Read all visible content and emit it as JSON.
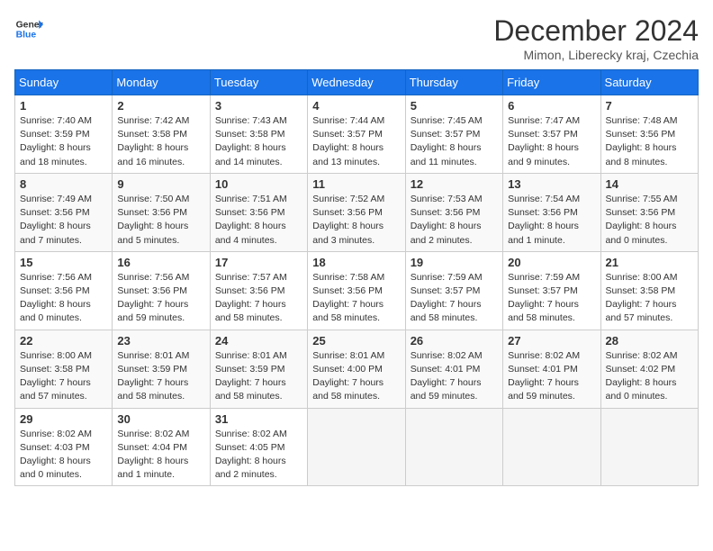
{
  "header": {
    "logo_line1": "General",
    "logo_line2": "Blue",
    "month_title": "December 2024",
    "subtitle": "Mimon, Liberecky kraj, Czechia"
  },
  "weekdays": [
    "Sunday",
    "Monday",
    "Tuesday",
    "Wednesday",
    "Thursday",
    "Friday",
    "Saturday"
  ],
  "weeks": [
    [
      {
        "day": "1",
        "info": "Sunrise: 7:40 AM\nSunset: 3:59 PM\nDaylight: 8 hours\nand 18 minutes."
      },
      {
        "day": "2",
        "info": "Sunrise: 7:42 AM\nSunset: 3:58 PM\nDaylight: 8 hours\nand 16 minutes."
      },
      {
        "day": "3",
        "info": "Sunrise: 7:43 AM\nSunset: 3:58 PM\nDaylight: 8 hours\nand 14 minutes."
      },
      {
        "day": "4",
        "info": "Sunrise: 7:44 AM\nSunset: 3:57 PM\nDaylight: 8 hours\nand 13 minutes."
      },
      {
        "day": "5",
        "info": "Sunrise: 7:45 AM\nSunset: 3:57 PM\nDaylight: 8 hours\nand 11 minutes."
      },
      {
        "day": "6",
        "info": "Sunrise: 7:47 AM\nSunset: 3:57 PM\nDaylight: 8 hours\nand 9 minutes."
      },
      {
        "day": "7",
        "info": "Sunrise: 7:48 AM\nSunset: 3:56 PM\nDaylight: 8 hours\nand 8 minutes."
      }
    ],
    [
      {
        "day": "8",
        "info": "Sunrise: 7:49 AM\nSunset: 3:56 PM\nDaylight: 8 hours\nand 7 minutes."
      },
      {
        "day": "9",
        "info": "Sunrise: 7:50 AM\nSunset: 3:56 PM\nDaylight: 8 hours\nand 5 minutes."
      },
      {
        "day": "10",
        "info": "Sunrise: 7:51 AM\nSunset: 3:56 PM\nDaylight: 8 hours\nand 4 minutes."
      },
      {
        "day": "11",
        "info": "Sunrise: 7:52 AM\nSunset: 3:56 PM\nDaylight: 8 hours\nand 3 minutes."
      },
      {
        "day": "12",
        "info": "Sunrise: 7:53 AM\nSunset: 3:56 PM\nDaylight: 8 hours\nand 2 minutes."
      },
      {
        "day": "13",
        "info": "Sunrise: 7:54 AM\nSunset: 3:56 PM\nDaylight: 8 hours\nand 1 minute."
      },
      {
        "day": "14",
        "info": "Sunrise: 7:55 AM\nSunset: 3:56 PM\nDaylight: 8 hours\nand 0 minutes."
      }
    ],
    [
      {
        "day": "15",
        "info": "Sunrise: 7:56 AM\nSunset: 3:56 PM\nDaylight: 8 hours\nand 0 minutes."
      },
      {
        "day": "16",
        "info": "Sunrise: 7:56 AM\nSunset: 3:56 PM\nDaylight: 7 hours\nand 59 minutes."
      },
      {
        "day": "17",
        "info": "Sunrise: 7:57 AM\nSunset: 3:56 PM\nDaylight: 7 hours\nand 58 minutes."
      },
      {
        "day": "18",
        "info": "Sunrise: 7:58 AM\nSunset: 3:56 PM\nDaylight: 7 hours\nand 58 minutes."
      },
      {
        "day": "19",
        "info": "Sunrise: 7:59 AM\nSunset: 3:57 PM\nDaylight: 7 hours\nand 58 minutes."
      },
      {
        "day": "20",
        "info": "Sunrise: 7:59 AM\nSunset: 3:57 PM\nDaylight: 7 hours\nand 58 minutes."
      },
      {
        "day": "21",
        "info": "Sunrise: 8:00 AM\nSunset: 3:58 PM\nDaylight: 7 hours\nand 57 minutes."
      }
    ],
    [
      {
        "day": "22",
        "info": "Sunrise: 8:00 AM\nSunset: 3:58 PM\nDaylight: 7 hours\nand 57 minutes."
      },
      {
        "day": "23",
        "info": "Sunrise: 8:01 AM\nSunset: 3:59 PM\nDaylight: 7 hours\nand 58 minutes."
      },
      {
        "day": "24",
        "info": "Sunrise: 8:01 AM\nSunset: 3:59 PM\nDaylight: 7 hours\nand 58 minutes."
      },
      {
        "day": "25",
        "info": "Sunrise: 8:01 AM\nSunset: 4:00 PM\nDaylight: 7 hours\nand 58 minutes."
      },
      {
        "day": "26",
        "info": "Sunrise: 8:02 AM\nSunset: 4:01 PM\nDaylight: 7 hours\nand 59 minutes."
      },
      {
        "day": "27",
        "info": "Sunrise: 8:02 AM\nSunset: 4:01 PM\nDaylight: 7 hours\nand 59 minutes."
      },
      {
        "day": "28",
        "info": "Sunrise: 8:02 AM\nSunset: 4:02 PM\nDaylight: 8 hours\nand 0 minutes."
      }
    ],
    [
      {
        "day": "29",
        "info": "Sunrise: 8:02 AM\nSunset: 4:03 PM\nDaylight: 8 hours\nand 0 minutes."
      },
      {
        "day": "30",
        "info": "Sunrise: 8:02 AM\nSunset: 4:04 PM\nDaylight: 8 hours\nand 1 minute."
      },
      {
        "day": "31",
        "info": "Sunrise: 8:02 AM\nSunset: 4:05 PM\nDaylight: 8 hours\nand 2 minutes."
      },
      {
        "day": "",
        "info": ""
      },
      {
        "day": "",
        "info": ""
      },
      {
        "day": "",
        "info": ""
      },
      {
        "day": "",
        "info": ""
      }
    ]
  ]
}
